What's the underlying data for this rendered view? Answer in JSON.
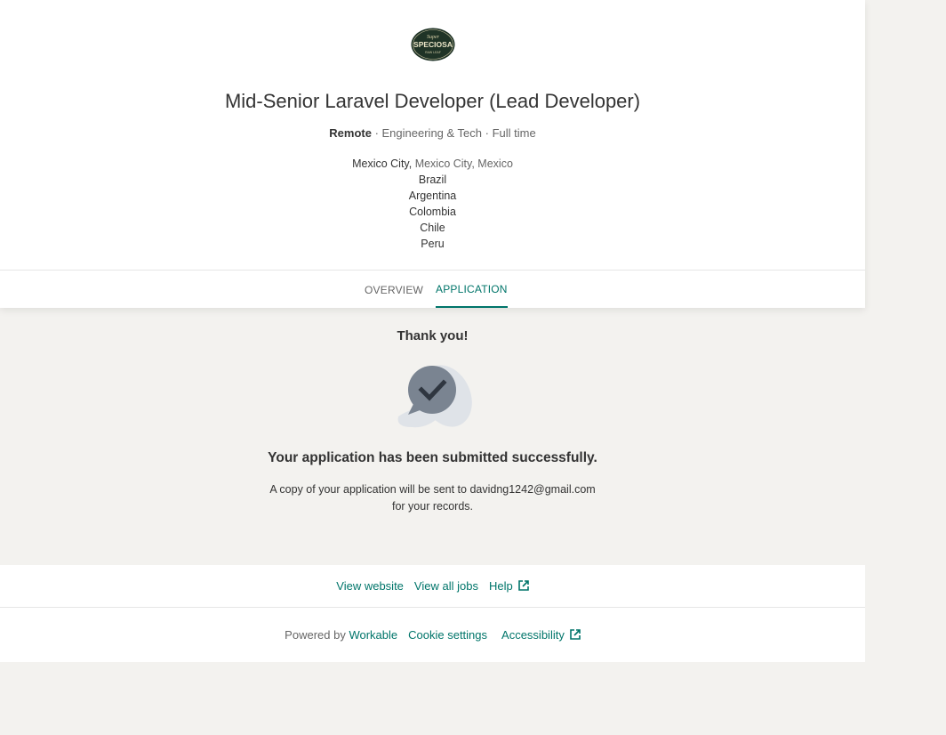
{
  "header": {
    "logo": {
      "name": "super-speciosa-logo",
      "text_top": "Super",
      "text_main": "SPECIOSA",
      "text_bottom": "RAW LEAF"
    },
    "job_title": "Mid-Senior Laravel Developer (Lead Developer)",
    "meta": {
      "workplace": "Remote",
      "separator": " · ",
      "department": "Engineering & Tech",
      "type": "Full time"
    },
    "locations": {
      "primary_city": "Mexico City,",
      "primary_rest": " Mexico City, Mexico",
      "others": [
        "Brazil",
        "Argentina",
        "Colombia",
        "Chile",
        "Peru"
      ]
    }
  },
  "tabs": [
    {
      "label": "OVERVIEW",
      "active": false
    },
    {
      "label": "APPLICATION",
      "active": true
    }
  ],
  "confirmation": {
    "heading": "Thank you!",
    "icon": "chat-check-icon",
    "message": "Your application has been submitted successfully.",
    "copy_line1": "A copy of your application will be sent to davidng1242@gmail.com",
    "copy_line2": "for your records."
  },
  "footer": {
    "links_row1": {
      "view_website": "View website",
      "view_all_jobs": "View all jobs",
      "help": "Help"
    },
    "powered_by": "Powered by",
    "workable": "Workable",
    "cookie_settings": "Cookie settings",
    "accessibility": "Accessibility"
  },
  "colors": {
    "accent": "#00756a",
    "background": "#f3f2ef",
    "icon_dark": "#7a8491",
    "icon_light": "#dfe3e8"
  }
}
